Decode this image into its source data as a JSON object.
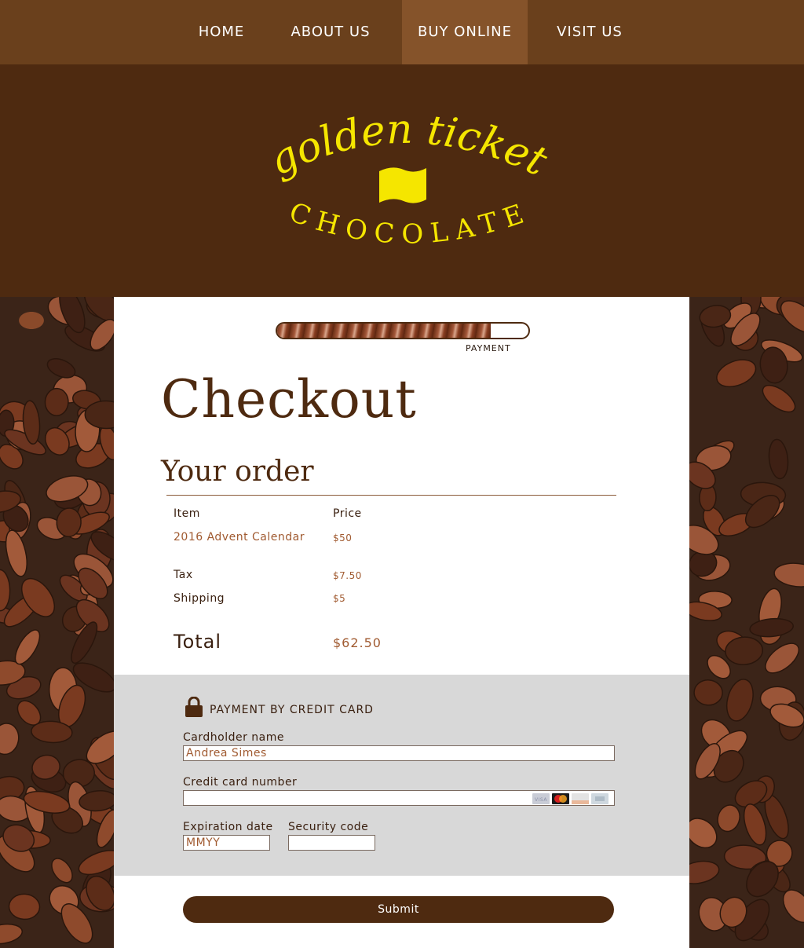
{
  "nav": {
    "items": [
      {
        "label": "HOME",
        "active": false
      },
      {
        "label": "ABOUT US",
        "active": false
      },
      {
        "label": "BUY ONLINE",
        "active": true
      },
      {
        "label": "VISIT US",
        "active": false
      }
    ]
  },
  "logo": {
    "line1": "golden ticket",
    "line2": "CHOCOLATE",
    "color": "#f5e600"
  },
  "progress": {
    "step_label": "PAYMENT",
    "fraction": 0.85
  },
  "checkout": {
    "title": "Checkout",
    "order_heading": "Your order",
    "columns": {
      "item": "Item",
      "price": "Price"
    },
    "items": [
      {
        "name": "2016 Advent Calendar",
        "price": "$50"
      }
    ],
    "tax": {
      "label": "Tax",
      "value": "$7.50"
    },
    "shipping": {
      "label": "Shipping",
      "value": "$5"
    },
    "total": {
      "label": "Total",
      "value": "$62.50"
    }
  },
  "payment": {
    "title": "PAYMENT BY CREDIT CARD",
    "cardholder": {
      "label": "Cardholder name",
      "value": "Andrea Simes"
    },
    "card_number": {
      "label": "Credit card number",
      "value": ""
    },
    "expiration": {
      "label": "Expiration date",
      "placeholder": "MMYY"
    },
    "security": {
      "label": "Security code",
      "value": ""
    },
    "card_icons": [
      "visa-icon",
      "mastercard-icon",
      "discover-icon",
      "amex-icon"
    ]
  },
  "submit_label": "Submit",
  "colors": {
    "brown_dark": "#4e2a10",
    "nav_bg": "#6a401c",
    "nav_active": "#85532a",
    "accent_text": "#a05a30",
    "logo_yellow": "#f5e600"
  }
}
